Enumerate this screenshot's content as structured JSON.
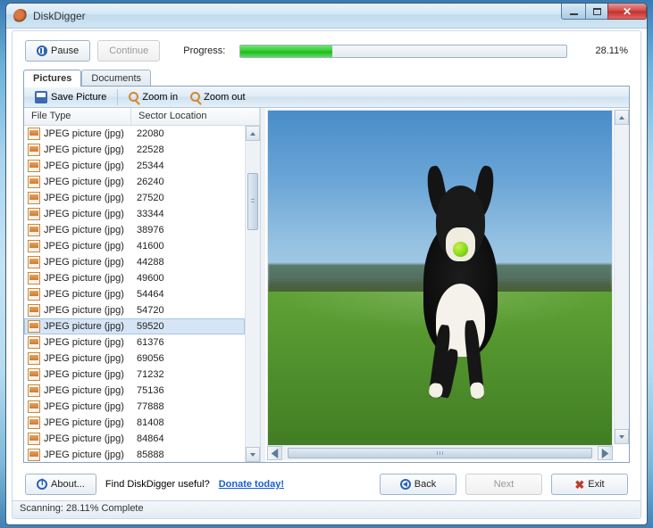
{
  "title": "DiskDigger",
  "toprow": {
    "pause_label": "Pause",
    "continue_label": "Continue",
    "progress_label": "Progress:",
    "progress_pct_text": "28.11%",
    "progress_pct_value": 28.11
  },
  "tabs": {
    "pictures": "Pictures",
    "documents": "Documents",
    "active": "pictures"
  },
  "toolbar": {
    "save": "Save Picture",
    "zoom_in": "Zoom in",
    "zoom_out": "Zoom out"
  },
  "list": {
    "header_filetype": "File Type",
    "header_sector": "Sector Location",
    "filetype_label": "JPEG picture (jpg)",
    "selected_index": 9,
    "rows": [
      {
        "sector": "22080"
      },
      {
        "sector": "22528"
      },
      {
        "sector": "25344"
      },
      {
        "sector": "26240"
      },
      {
        "sector": "27520"
      },
      {
        "sector": "33344"
      },
      {
        "sector": "38976"
      },
      {
        "sector": "41600"
      },
      {
        "sector": "44288"
      },
      {
        "sector": "49600"
      },
      {
        "sector": "54464"
      },
      {
        "sector": "54720"
      },
      {
        "sector": "59520"
      },
      {
        "sector": "61376"
      },
      {
        "sector": "69056"
      },
      {
        "sector": "71232"
      },
      {
        "sector": "75136"
      },
      {
        "sector": "77888"
      },
      {
        "sector": "81408"
      },
      {
        "sector": "84864"
      },
      {
        "sector": "85888"
      }
    ]
  },
  "bottom": {
    "about": "About...",
    "useful_text": "Find DiskDigger useful?",
    "donate": "Donate today!",
    "back": "Back",
    "next": "Next",
    "exit": "Exit"
  },
  "status": "Scanning: 28.11% Complete"
}
